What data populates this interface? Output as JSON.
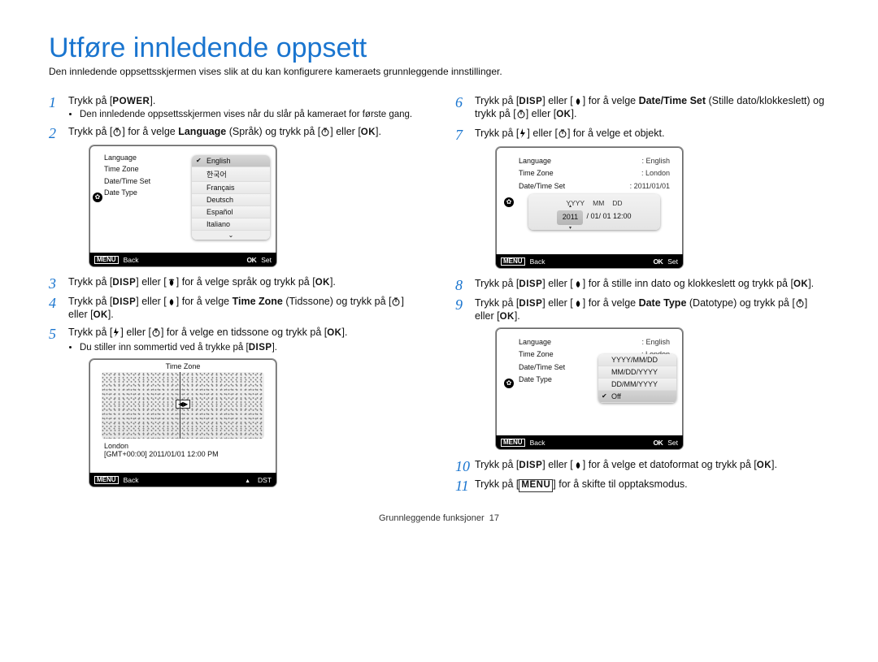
{
  "title": "Utføre innledende oppsett",
  "subtitle": "Den innledende oppsettsskjermen vises slik at du kan konfigurere kameraets grunnleggende innstillinger.",
  "buttons": {
    "power": "POWER",
    "disp": "DISP",
    "ok": "OK",
    "menu": "MENU"
  },
  "left_steps": {
    "s1": {
      "text_a": "Trykk på [",
      "text_b": "].",
      "sub": "Den innledende oppsettsskjermen vises når du slår på kameraet for første gang."
    },
    "s2": {
      "text_a": "Trykk på [",
      "text_b": "] for å velge ",
      "lang_bold": "Language",
      "lang_paren": " (Språk) og trykk på [",
      "text_c": "] eller [",
      "text_d": "]."
    },
    "s3": "] for å velge språk og trykk på [",
    "s4": {
      "a": "] for å velge ",
      "tz": "Time Zone",
      "b": " (Tidssone) og trykk på [",
      "c": "] eller ["
    },
    "s5": {
      "a": "] for å velge en tidssone og trykk på [",
      "sub": "Du stiller inn sommertid ved å trykke på ["
    }
  },
  "right_steps": {
    "s6": {
      "a": "] for å velge ",
      "dts": "Date/Time Set",
      "b": " (Stille dato/klokkeslett) og trykk på ["
    },
    "s7": "] for å velge et objekt.",
    "s8": "] for å stille inn dato og klokkeslett og trykk på [",
    "s9": {
      "a": "] for å velge ",
      "dt": "Date Type",
      "b": " (Datotype) og trykk på [",
      "c": "] eller ["
    },
    "s10": "] for å velge et datoformat og trykk på [",
    "s11": "] for å skifte til opptaksmodus."
  },
  "generic": {
    "trykk_pa": "Trykk på [",
    "eller": "] eller [",
    "end": "].",
    "dot": "]."
  },
  "screen_lang": {
    "items": [
      "Language",
      "Time Zone",
      "Date/Time Set",
      "Date Type"
    ],
    "popup": [
      "English",
      "한국어",
      "Français",
      "Deutsch",
      "Español",
      "Italiano"
    ],
    "footer_back": "Back",
    "footer_set": "Set"
  },
  "screen_tz": {
    "title": "Time Zone",
    "city": "London",
    "gmt": "[GMT+00:00]   2011/01/01   12:00 PM",
    "footer_back": "Back",
    "footer_dst": "DST"
  },
  "screen_dt": {
    "rows": [
      {
        "k": "Language",
        "v": ": English"
      },
      {
        "k": "Time Zone",
        "v": ": London"
      },
      {
        "k": "Date/Time Set",
        "v": ": 2011/01/01"
      }
    ],
    "labels": [
      "YYYY",
      "MM",
      "DD"
    ],
    "values": [
      "2011",
      "/ 01/ 01   12:00"
    ],
    "footer_back": "Back",
    "footer_set": "Set"
  },
  "screen_datetype": {
    "rows": [
      {
        "k": "Language",
        "v": ": English"
      },
      {
        "k": "Time Zone",
        "v": ": London"
      },
      {
        "k": "Date/Time Set",
        "v": ""
      },
      {
        "k": "Date Type",
        "v": ""
      }
    ],
    "popup": [
      "YYYY/MM/DD",
      "MM/DD/YYYY",
      "DD/MM/YYYY",
      "Off"
    ],
    "footer_back": "Back",
    "footer_set": "Set"
  },
  "footer": {
    "section": "Grunnleggende funksjoner",
    "page": "17"
  }
}
